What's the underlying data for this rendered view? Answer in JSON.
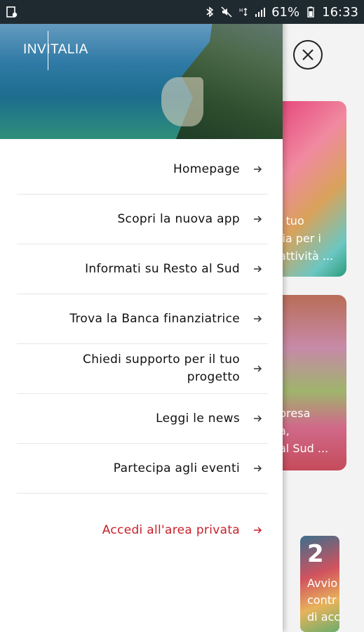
{
  "status_bar": {
    "battery": "61%",
    "time": "16:33"
  },
  "brand": {
    "logo_text": "INVITALIA"
  },
  "menu": {
    "items": [
      {
        "label": "Homepage"
      },
      {
        "label": "Scopri la nuova app"
      },
      {
        "label": "Informati su Resto al Sud"
      },
      {
        "label": "Trova la Banca finanziatrice"
      },
      {
        "label": "Chiedi supporto per il tuo progetto"
      },
      {
        "label": "Leggi le news"
      },
      {
        "label": "Partecipa agli eventi"
      }
    ],
    "private_area": "Accedi all'area privata"
  },
  "background_cards": [
    {
      "lines": [
        "l tuo",
        "lia per i",
        "attività ..."
      ]
    },
    {
      "lines": [
        "presa",
        "a,",
        "al Sud ..."
      ]
    },
    {
      "number": "2",
      "lines": [
        "Avvio",
        "contr",
        "di acc"
      ]
    }
  ],
  "colors": {
    "accent_red": "#c8202a",
    "status_bar": "#1f2a30"
  }
}
